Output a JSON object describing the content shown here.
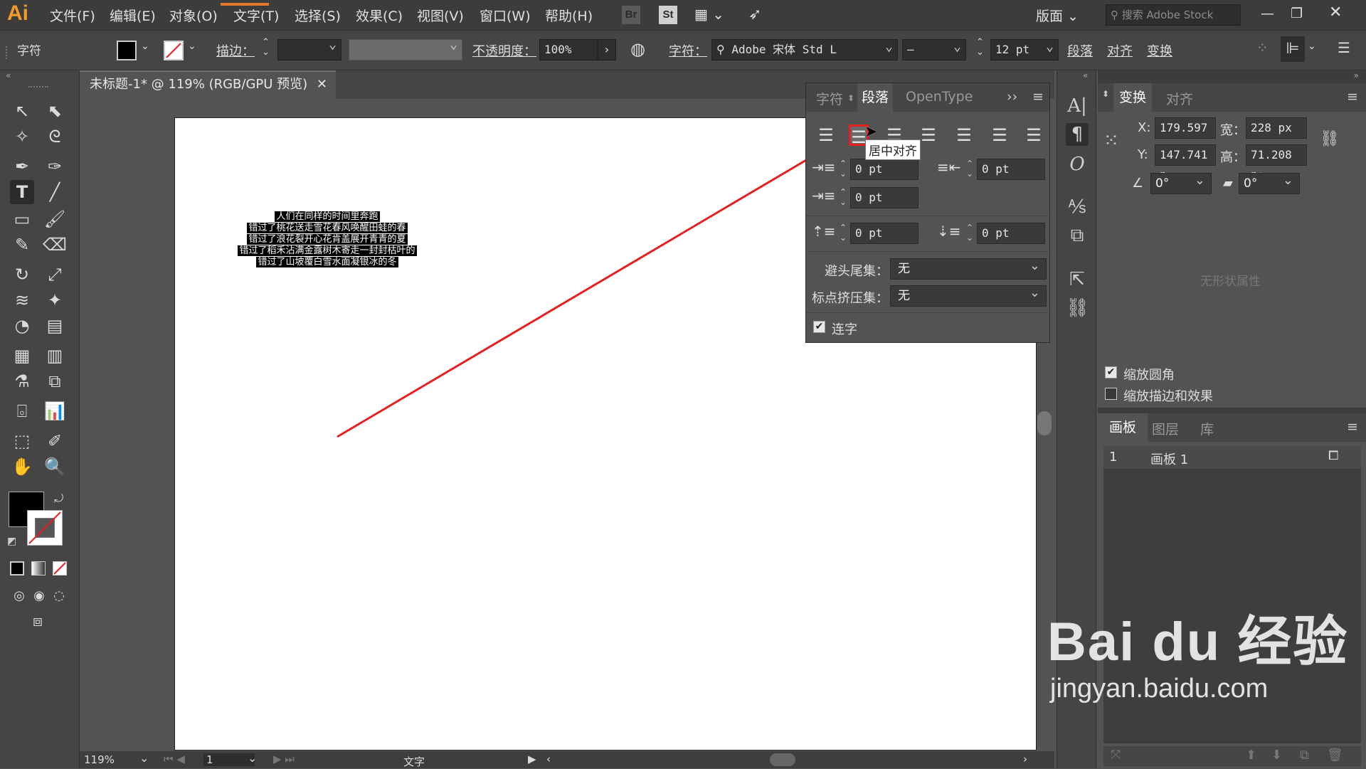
{
  "menubar": {
    "logo": "Ai",
    "items": [
      "文件(F)",
      "编辑(E)",
      "对象(O)",
      "文字(T)",
      "选择(S)",
      "效果(C)",
      "视图(V)",
      "窗口(W)",
      "帮助(H)"
    ],
    "br_icon": "Br",
    "st_icon": "St",
    "workspace": "版面",
    "search_placeholder": "搜索 Adobe Stock"
  },
  "control_bar": {
    "object_type": "字符",
    "stroke_label": "描边：",
    "opacity_label": "不透明度：",
    "opacity_value": "100%",
    "char_label": "字符：",
    "font_name": "Adobe 宋体 Std L",
    "font_style": "–",
    "font_size": "12 pt",
    "paragraph_link": "段落",
    "align_link": "对齐",
    "transform_link": "变换"
  },
  "document": {
    "tab_title": "未标题-1* @ 119% (RGB/GPU 预览)",
    "text_lines": [
      "人们在同样的时间里奔跑",
      "错过了桃花送走雪花春风唤醒田蛙的春",
      "错过了浪花裂开心花肯盖展开青青的夏",
      "错过了稻禾沾满金露树木寄走一封封枯叶的",
      "错过了山坡覆白雪水面凝银冰的冬"
    ]
  },
  "statusbar": {
    "zoom": "119%",
    "artboard_num": "1",
    "tool_name": "文字"
  },
  "paragraph_panel": {
    "tabs": [
      "字符",
      "段落",
      "OpenType"
    ],
    "active_tab": "段落",
    "left_indent": "0 pt",
    "right_indent": "0 pt",
    "first_line_indent": "0 pt",
    "space_before": "0 pt",
    "space_after": "0 pt",
    "kinsoku_label": "避头尾集：",
    "kinsoku_value": "无",
    "mojikumi_label": "标点挤压集：",
    "mojikumi_value": "无",
    "hyphenate_label": "连字",
    "tooltip": "居中对齐"
  },
  "transform_panel": {
    "tabs": [
      "变换",
      "对齐"
    ],
    "x_label": "X:",
    "x_value": "179.597 p",
    "y_label": "Y:",
    "y_value": "147.741 p",
    "w_label": "宽：",
    "w_value": "228 px",
    "h_label": "高：",
    "h_value": "71.208 p:",
    "angle_value": "0°",
    "shear_value": "0°",
    "no_shape_props": "无形状属性",
    "scale_corners": "缩放圆角",
    "scale_strokes": "缩放描边和效果"
  },
  "artboards_panel": {
    "tabs": [
      "画板",
      "图层",
      "库"
    ],
    "row_num": "1",
    "row_name": "画板 1"
  },
  "watermark": {
    "brand": "Bai du 经验",
    "url": "jingyan.baidu.com"
  },
  "colors": {
    "accent_red": "#e62020",
    "app_bg": "#535353",
    "panel_dark": "#454545"
  }
}
